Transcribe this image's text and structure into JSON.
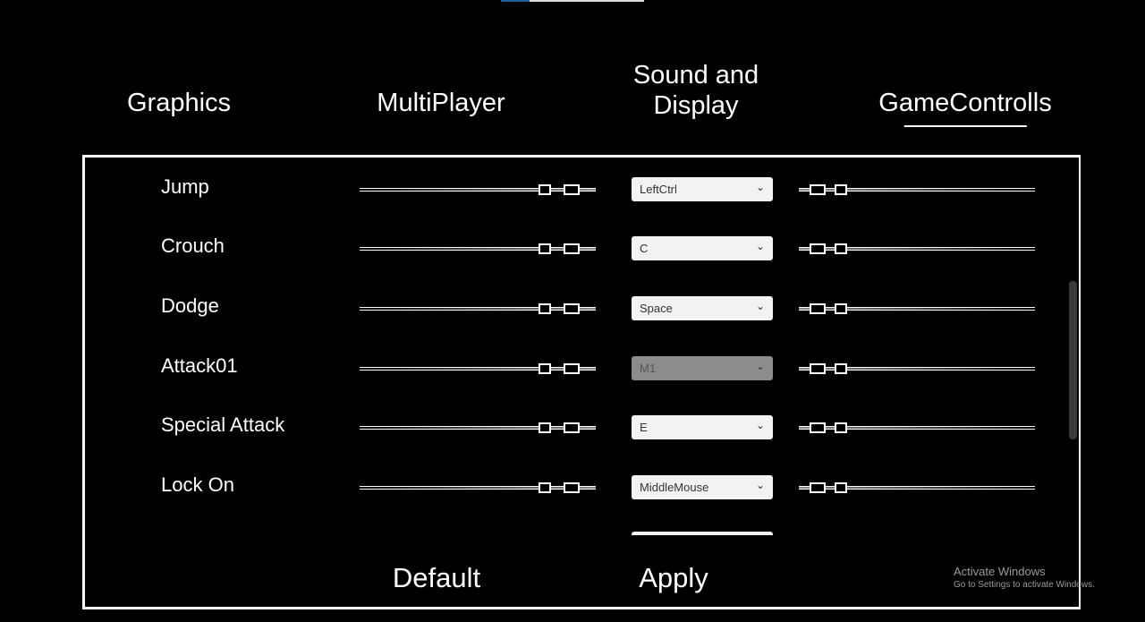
{
  "loading_progress": 0.2,
  "colors": {
    "progress": "#1f5fa8",
    "accent": "#ffffff"
  },
  "tabs": [
    {
      "label": "Graphics",
      "active": false
    },
    {
      "label": "MultiPlayer",
      "active": false
    },
    {
      "label": "Sound and Display",
      "line1": "Sound and",
      "line2": "Display",
      "active": false
    },
    {
      "label": "GameControlls",
      "active": true
    }
  ],
  "controls": [
    {
      "label": "Jump",
      "key": "LeftCtrl",
      "disabled": false
    },
    {
      "label": "Crouch",
      "key": "C",
      "disabled": false
    },
    {
      "label": "Dodge",
      "key": "Space",
      "disabled": false
    },
    {
      "label": "Attack01",
      "key": "M1",
      "disabled": true
    },
    {
      "label": "Special Attack",
      "key": "E",
      "disabled": false
    },
    {
      "label": "Lock On",
      "key": "MiddleMouse",
      "disabled": false
    }
  ],
  "buttons": {
    "default": "Default",
    "apply": "Apply"
  },
  "watermark": {
    "title": "Activate Windows",
    "subtitle": "Go to Settings to activate Windows."
  }
}
